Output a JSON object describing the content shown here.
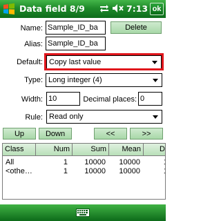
{
  "titlebar": {
    "title": "Data field 8/9",
    "time": "7:13",
    "ok_label": "ok"
  },
  "form": {
    "name_label": "Name:",
    "name_value": "Sample_ID_ba",
    "delete_label": "Delete",
    "alias_label": "Alias:",
    "alias_value": "Sample_ID_ba",
    "default_label": "Default:",
    "default_value": "Copy last value",
    "type_label": "Type:",
    "type_value": "Long integer (4)",
    "width_label": "Width:",
    "width_value": "10",
    "decimal_label": "Decimal places:",
    "decimal_value": "0",
    "rule_label": "Rule:",
    "rule_value": "Read only"
  },
  "nav": {
    "up_label": "Up",
    "down_label": "Down",
    "prev_label": "<<",
    "next_label": ">>"
  },
  "table": {
    "columns": [
      "Class",
      "Num",
      "Sum",
      "Mean",
      "D"
    ],
    "rows": [
      [
        "All",
        "1",
        "10000",
        "10000",
        "1"
      ],
      [
        "<othe…",
        "1",
        "10000",
        "10000",
        "1"
      ]
    ]
  },
  "icons": {
    "start": "windows-logo-icon",
    "connectivity": "connectivity-icon",
    "volume": "speaker-muted-icon",
    "keyboard": "keyboard-icon"
  },
  "colors": {
    "titlebar": "#1f8a2a",
    "highlight": "#e0151b",
    "button": "#b8e0b8"
  }
}
